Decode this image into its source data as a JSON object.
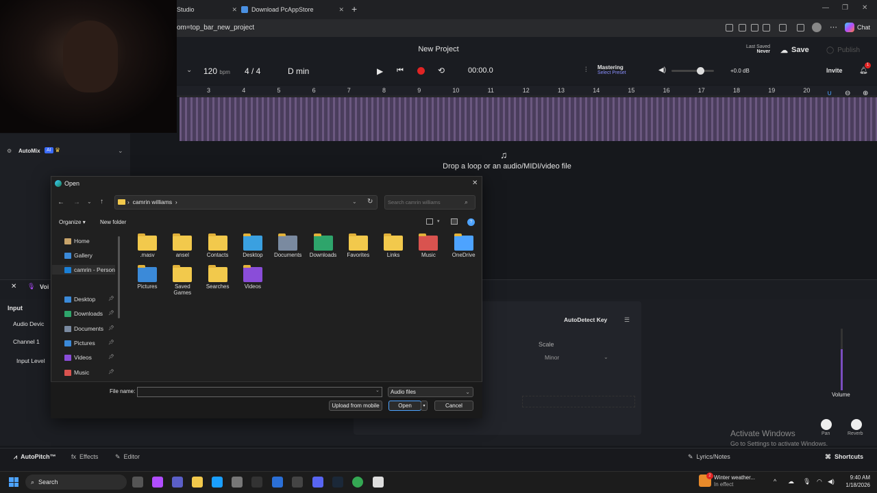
{
  "browser": {
    "tab1": "Studio",
    "tab2": "Download PcAppStore",
    "url": "om=top_bar_new_project",
    "chat": "Chat"
  },
  "app": {
    "title": "New Project",
    "last_saved_label": "Last Saved",
    "last_saved_value": "Never",
    "save": "Save",
    "publish": "Publish",
    "bpm_value": "120",
    "bpm_unit": "bpm",
    "time_sig": "4 / 4",
    "key": "D min",
    "time": "00:00.0",
    "mastering": "Mastering",
    "select_preset": "Select Preset",
    "volume_db": "+0.0 dB",
    "invite": "Invite",
    "notif_count": "1",
    "ruler": [
      "3",
      "4",
      "5",
      "6",
      "7",
      "8",
      "9",
      "10",
      "11",
      "12",
      "13",
      "14",
      "15",
      "16",
      "17",
      "18",
      "19",
      "20"
    ],
    "automix": "AutoMix",
    "ai_badge": "AI",
    "drop_text": "Drop a loop or an audio/MIDI/video file",
    "voice": "Voi",
    "input": "Input",
    "audio_device": "Audio Devic",
    "channel": "Channel 1",
    "input_level": "Input Level",
    "autodetect": "AutoDetect Key",
    "scale": "Scale",
    "scale_value": "Minor",
    "volume": "Volume",
    "pan": "Pan",
    "reverb": "Reverb",
    "autopitch": "AutoPitch™",
    "effects": "Effects",
    "editor": "Editor",
    "lyrics": "Lyrics/Notes",
    "shortcuts": "Shortcuts",
    "activate_title": "Activate Windows",
    "activate_sub": "Go to Settings to activate Windows."
  },
  "dialog": {
    "title": "Open",
    "path": "camrin williams",
    "search_placeholder": "Search camrin williams",
    "organize": "Organize",
    "new_folder": "New folder",
    "nav": [
      {
        "label": "Home",
        "pin": false
      },
      {
        "label": "Gallery",
        "pin": false
      },
      {
        "label": "camrin - Person",
        "pin": false
      },
      {
        "label": "Desktop",
        "pin": true
      },
      {
        "label": "Downloads",
        "pin": true
      },
      {
        "label": "Documents",
        "pin": true
      },
      {
        "label": "Pictures",
        "pin": true
      },
      {
        "label": "Videos",
        "pin": true
      },
      {
        "label": "Music",
        "pin": true
      }
    ],
    "files": [
      ".masv",
      "ansel",
      "Contacts",
      "Desktop",
      "Documents",
      "Downloads",
      "Favorites",
      "Links",
      "Music",
      "OneDrive",
      "Pictures",
      "Saved Games",
      "Searches",
      "Videos"
    ],
    "file_name_label": "File name:",
    "file_name_value": "",
    "file_type": "Audio files",
    "upload": "Upload from mobile",
    "open": "Open",
    "cancel": "Cancel"
  },
  "taskbar": {
    "search": "Search",
    "weather_title": "Winter weather...",
    "weather_sub": "In effect",
    "weather_badge": "2",
    "time": "9:40 AM",
    "date": "1/18/2026"
  },
  "colors": {
    "accent": "#4da3ff",
    "record": "#e02424",
    "folder": "#f2c94c",
    "midi": "#6b5880"
  }
}
